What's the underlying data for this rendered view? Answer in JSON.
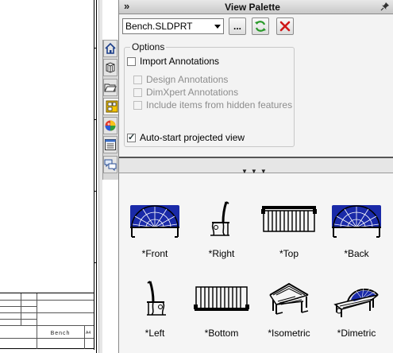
{
  "title_block": {
    "part_name": "Bench",
    "rev": "A4"
  },
  "panel": {
    "title": "View Palette",
    "collapse_glyph": "»"
  },
  "toolbar": {
    "document": "Bench.SLDPRT",
    "browse_label": "..."
  },
  "options": {
    "group_label": "Options",
    "import_annotations": {
      "label": "Import Annotations",
      "checked": false
    },
    "design_annotations": {
      "label": "Design Annotations",
      "checked": false,
      "enabled": false
    },
    "dimxpert_annotations": {
      "label": "DimXpert Annotations",
      "checked": false,
      "enabled": false
    },
    "hidden_features": {
      "label": "Include items from hidden features",
      "checked": false,
      "enabled": false
    },
    "auto_start": {
      "label": "Auto-start projected view",
      "checked": true
    }
  },
  "views": [
    {
      "label": "*Front",
      "icon": "bench-front-view"
    },
    {
      "label": "*Right",
      "icon": "bench-right-view"
    },
    {
      "label": "*Top",
      "icon": "bench-top-view"
    },
    {
      "label": "*Back",
      "icon": "bench-back-view"
    },
    {
      "label": "*Left",
      "icon": "bench-left-view"
    },
    {
      "label": "*Bottom",
      "icon": "bench-bottom-view"
    },
    {
      "label": "*Isometric",
      "icon": "bench-isometric-view"
    },
    {
      "label": "*Dimetric",
      "icon": "bench-dimetric-view"
    }
  ],
  "task_pane_tabs": [
    {
      "icon": "home-icon"
    },
    {
      "icon": "design-library-icon"
    },
    {
      "icon": "file-explorer-icon"
    },
    {
      "icon": "view-palette-icon",
      "active": true
    },
    {
      "icon": "appearances-icon"
    },
    {
      "icon": "custom-properties-icon"
    },
    {
      "icon": "forum-icon"
    }
  ],
  "colors": {
    "refresh": "#2a9a2a",
    "clear": "#d01818",
    "highlight_blue": "#1a2aa8"
  }
}
